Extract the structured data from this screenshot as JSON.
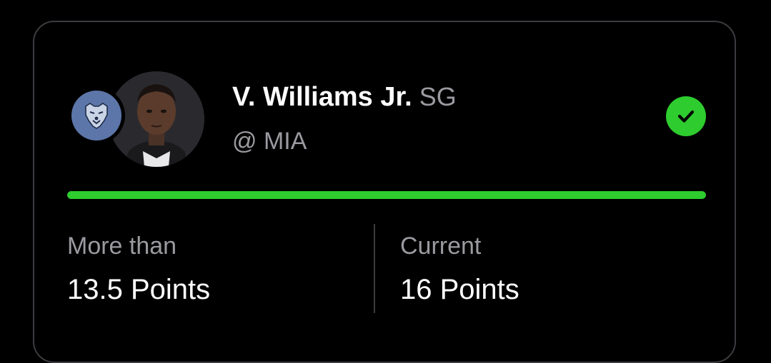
{
  "player": {
    "name": "V. Williams Jr.",
    "position": "SG",
    "opponent": "@ MIA",
    "team_logo_icon": "grizzlies-bear-icon",
    "team_color": "#5d76a9"
  },
  "status": {
    "icon": "check-icon",
    "color": "#2ecc2e",
    "progress_fraction": 1.0
  },
  "line": {
    "label": "More than",
    "value": "13.5 Points"
  },
  "current": {
    "label": "Current",
    "value": "16 Points"
  }
}
